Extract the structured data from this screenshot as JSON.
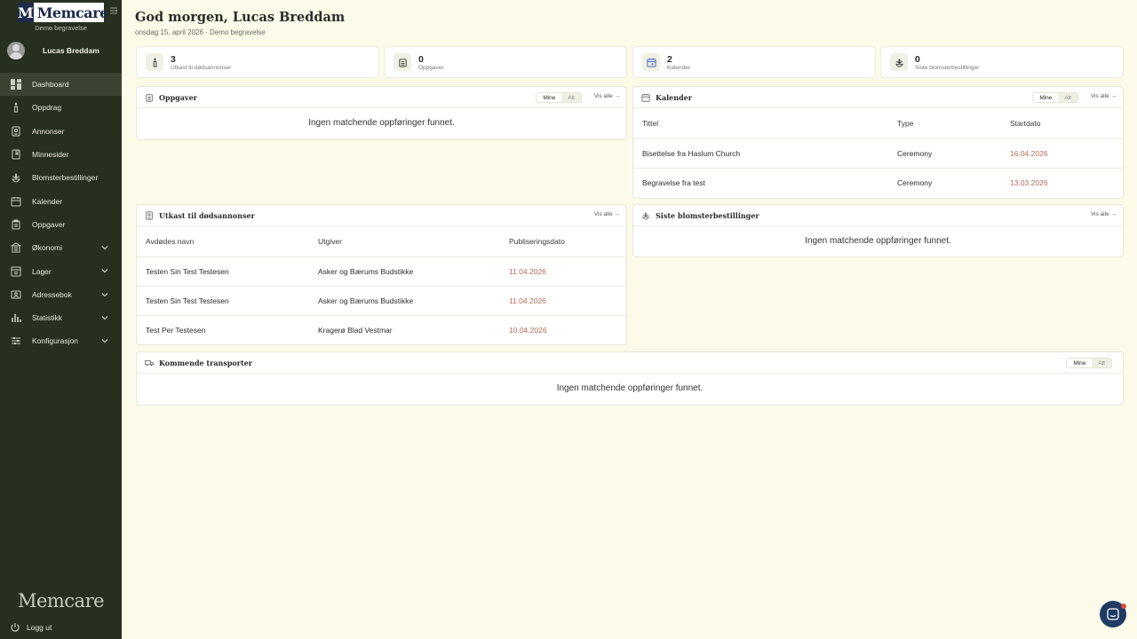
{
  "brand": {
    "logo_letter": "M",
    "logo_name": "Memcare",
    "subtitle": "Demo begravelse",
    "bottom_wordmark": "Memcare"
  },
  "user": {
    "name": "Lucas Breddam"
  },
  "nav": [
    {
      "label": "Dashboard",
      "icon": "dashboard-icon",
      "active": true
    },
    {
      "label": "Oppdrag",
      "icon": "candle-icon"
    },
    {
      "label": "Annonser",
      "icon": "document-icon"
    },
    {
      "label": "Minnesider",
      "icon": "book-icon"
    },
    {
      "label": "Blomsterbestillinger",
      "icon": "flower-icon"
    },
    {
      "label": "Kalender",
      "icon": "calendar-icon"
    },
    {
      "label": "Oppgaver",
      "icon": "clipboard-icon"
    },
    {
      "label": "Økonomi",
      "icon": "bank-icon",
      "expandable": true
    },
    {
      "label": "Lager",
      "icon": "inventory-icon",
      "expandable": true
    },
    {
      "label": "Adressebok",
      "icon": "contacts-icon",
      "expandable": true
    },
    {
      "label": "Statistikk",
      "icon": "bar-chart-icon",
      "expandable": true
    },
    {
      "label": "Konfigurasjon",
      "icon": "sliders-icon",
      "expandable": true
    }
  ],
  "logout_label": "Logg ut",
  "header": {
    "greeting": "God morgen, Lucas Breddam",
    "date_line": "onsdag 15. april 2026 · Demo begravelse"
  },
  "stats": [
    {
      "count": "3",
      "label": "Utkast til dødsannonser",
      "icon": "candle-icon"
    },
    {
      "count": "0",
      "label": "Oppgaver",
      "icon": "clipboard-icon"
    },
    {
      "count": "2",
      "label": "Kalender",
      "icon": "calendar-icon",
      "accent": "#2f5bbd"
    },
    {
      "count": "0",
      "label": "Siste blomsterbestillinger",
      "icon": "flower-icon"
    }
  ],
  "toggle": {
    "mine": "Mine",
    "alt": "Alt"
  },
  "vis_alle": "Vis alle →",
  "empty_text": "Ingen matchende oppføringer funnet.",
  "oppgaver": {
    "title": "Oppgaver"
  },
  "kalender": {
    "title": "Kalender",
    "columns": [
      "Tittel",
      "Type",
      "Startdato"
    ],
    "rows": [
      [
        "Bisettelse fra Haslum Church",
        "Ceremony",
        "16.04.2026"
      ],
      [
        "Begravelse fra test",
        "Ceremony",
        "13.03.2026"
      ]
    ]
  },
  "utkast": {
    "title": "Utkast til dødsannonser",
    "columns": [
      "Avdødes navn",
      "Utgiver",
      "Publiseringsdato"
    ],
    "rows": [
      [
        "Testen Sin Test Testesen",
        "Asker og Bærums Budstikke",
        "11.04.2026"
      ],
      [
        "Testen Sin Test Testesen",
        "Asker og Bærums Budstikke",
        "11.04.2026"
      ],
      [
        "Test Per Testesen",
        "Kragerø Blad Vestmar",
        "10.04.2026"
      ]
    ]
  },
  "blomster": {
    "title": "Siste blomsterbestillinger"
  },
  "transporter": {
    "title": "Kommende transporter"
  }
}
